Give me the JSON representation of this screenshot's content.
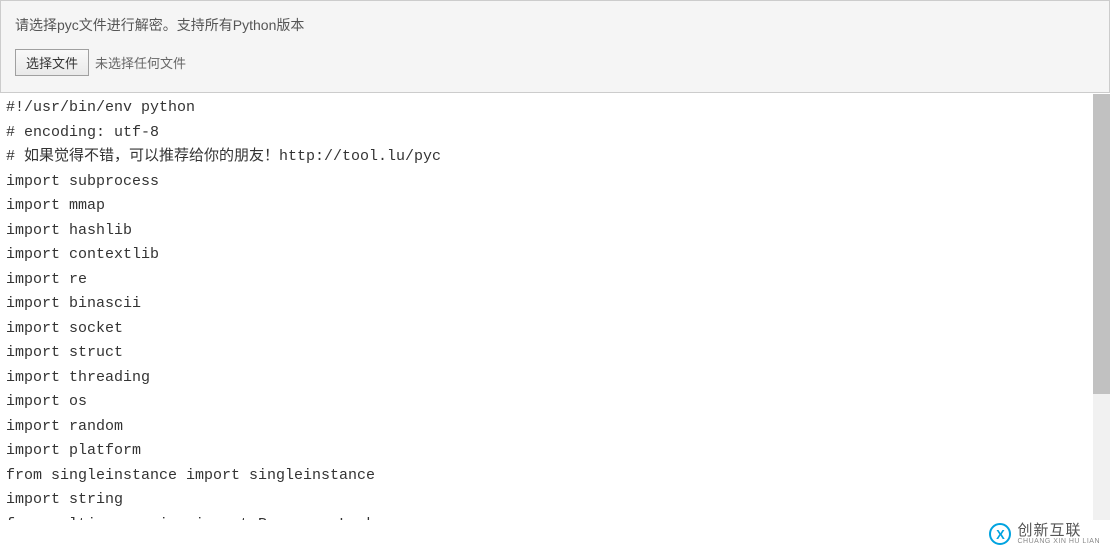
{
  "upload": {
    "description": "请选择pyc文件进行解密。支持所有Python版本",
    "button_label": "选择文件",
    "no_file_text": "未选择任何文件"
  },
  "code_lines": [
    "#!/usr/bin/env python",
    "# encoding: utf-8",
    "# 如果觉得不错，可以推荐给你的朋友！http://tool.lu/pyc",
    "import subprocess",
    "import mmap",
    "import hashlib",
    "import contextlib",
    "import re",
    "import binascii",
    "import socket",
    "import struct",
    "import threading",
    "import os",
    "import random",
    "import platform",
    "from singleinstance import singleinstance",
    "import string",
    "from multiprocessing import Process, Lock"
  ],
  "watermark": {
    "main": "创新互联",
    "sub": "CHUANG XIN HU LIAN"
  }
}
